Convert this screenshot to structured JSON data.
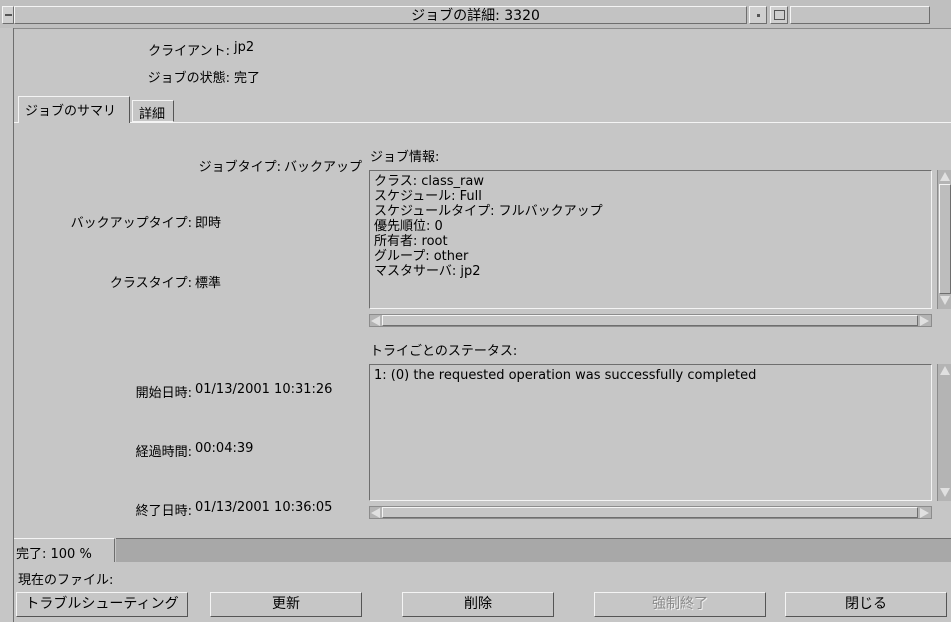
{
  "window": {
    "title": "ジョブの詳細: 3320"
  },
  "header": {
    "client_label": "クライアント:",
    "client_value": "jp2",
    "status_label": "ジョブの状態:",
    "status_value": "完了"
  },
  "tabs": [
    {
      "label": "ジョブのサマリ",
      "active": true
    },
    {
      "label": "詳細",
      "active": false
    }
  ],
  "summary": {
    "job_type_label": "ジョブタイプ:",
    "job_type_value": "バックアップ",
    "backup_type_label": "バックアップタイプ:",
    "backup_type_value": "即時",
    "class_type_label": "クラスタイプ:",
    "class_type_value": "標準",
    "start_label": "開始日時:",
    "start_value": "01/13/2001 10:31:26",
    "elapsed_label": "経過時間:",
    "elapsed_value": "00:04:39",
    "end_label": "終了日時:",
    "end_value": "01/13/2001 10:36:05"
  },
  "job_info": {
    "heading": "ジョブ情報:",
    "lines": [
      "クラス: class_raw",
      "スケジュール: Full",
      "スケジュールタイプ: フルバックアップ",
      "優先順位: 0",
      "所有者: root",
      "グループ: other",
      "マスタサーバ: jp2"
    ]
  },
  "try_status": {
    "heading": "トライごとのステータス:",
    "lines": [
      "1: (0) the requested operation was successfully completed"
    ]
  },
  "progress": {
    "label": "完了: 100 %",
    "percent": 100,
    "current_file_label": "現在のファイル:"
  },
  "buttons": {
    "troubleshoot": "トラブルシューティング",
    "refresh": "更新",
    "delete": "削除",
    "force_end": "強制終了",
    "close": "閉じる"
  },
  "colors": {
    "background": "#c6c6c6",
    "progress_fill": "#a8a8a8"
  }
}
